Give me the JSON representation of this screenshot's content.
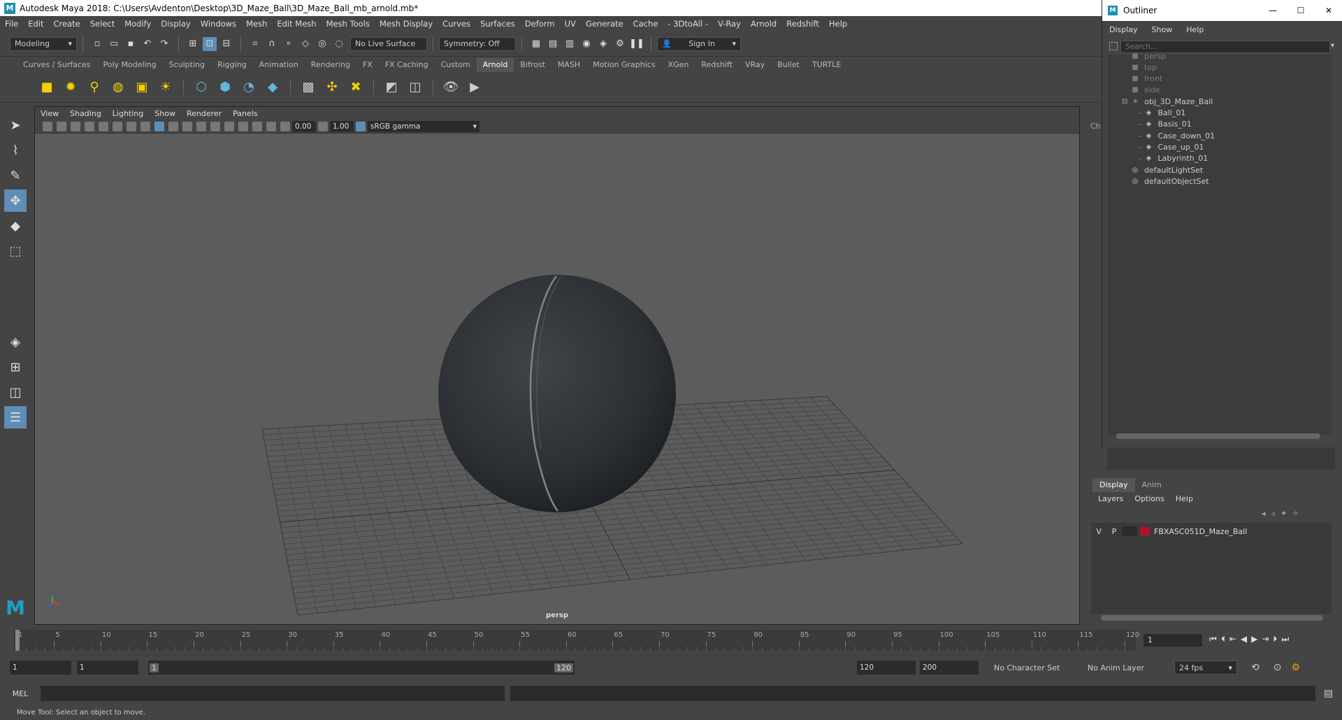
{
  "window": {
    "title": "Autodesk Maya 2018: C:\\Users\\Avdenton\\Desktop\\3D_Maze_Ball\\3D_Maze_Ball_mb_arnold.mb*"
  },
  "menubar": [
    "File",
    "Edit",
    "Create",
    "Select",
    "Modify",
    "Display",
    "Windows",
    "Mesh",
    "Edit Mesh",
    "Mesh Tools",
    "Mesh Display",
    "Curves",
    "Surfaces",
    "Deform",
    "UV",
    "Generate",
    "Cache",
    "- 3DtoAll -",
    "V-Ray",
    "Arnold",
    "Redshift",
    "Help"
  ],
  "statusline": {
    "mode": "Modeling",
    "live_surface": "No Live Surface",
    "symmetry": "Symmetry: Off",
    "sign_in": "Sign In"
  },
  "shelf_tabs": [
    "Curves / Surfaces",
    "Poly Modeling",
    "Sculpting",
    "Rigging",
    "Animation",
    "Rendering",
    "FX",
    "FX Caching",
    "Custom",
    "Arnold",
    "Bifrost",
    "MASH",
    "Motion Graphics",
    "XGen",
    "Redshift",
    "VRay",
    "Bullet",
    "TURTLE"
  ],
  "shelf_active": "Arnold",
  "viewport": {
    "menu": [
      "View",
      "Shading",
      "Lighting",
      "Show",
      "Renderer",
      "Panels"
    ],
    "exposure": "0.00",
    "gamma": "1.00",
    "color_space": "sRGB gamma",
    "camera": "persp"
  },
  "outliner": {
    "title": "Outliner",
    "menu": [
      "Display",
      "Show",
      "Help"
    ],
    "search_placeholder": "Search...",
    "items": [
      {
        "label": "persp",
        "dim": true
      },
      {
        "label": "top",
        "dim": true
      },
      {
        "label": "front",
        "dim": true
      },
      {
        "label": "side",
        "dim": true
      },
      {
        "label": "obj_3D_Maze_Ball",
        "dim": false
      },
      {
        "label": "Ball_01",
        "dim": false
      },
      {
        "label": "Basis_01",
        "dim": false
      },
      {
        "label": "Case_down_01",
        "dim": false
      },
      {
        "label": "Case_up_01",
        "dim": false
      },
      {
        "label": "Labyrinth_01",
        "dim": false
      },
      {
        "label": "defaultLightSet",
        "dim": false
      },
      {
        "label": "defaultObjectSet",
        "dim": false
      }
    ]
  },
  "channel_box_tab": "Ch",
  "layers": {
    "tabs": [
      "Display",
      "Anim"
    ],
    "menu": [
      "Layers",
      "Options",
      "Help"
    ],
    "row": {
      "v": "V",
      "p": "P",
      "name": "FBXASC051D_Maze_Ball",
      "color": "#b3122e"
    }
  },
  "timeline": {
    "ticks": [
      "1",
      "5",
      "10",
      "15",
      "20",
      "25",
      "30",
      "35",
      "40",
      "45",
      "50",
      "55",
      "60",
      "65",
      "70",
      "75",
      "80",
      "85",
      "90",
      "95",
      "100",
      "105",
      "110",
      "115",
      "120"
    ],
    "current_frame": "1"
  },
  "range": {
    "start": "1",
    "inner_start": "1",
    "slider_start": "1",
    "slider_end": "120",
    "end": "120",
    "max_end": "200",
    "character_set": "No Character Set",
    "anim_layer": "No Anim Layer",
    "fps": "24 fps"
  },
  "cmd": {
    "label": "MEL"
  },
  "help_line": "Move Tool: Select an object to move."
}
